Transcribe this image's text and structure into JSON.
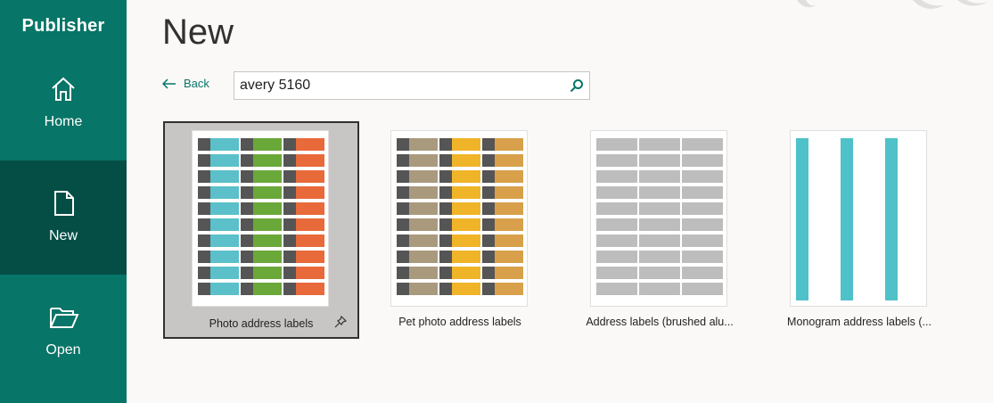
{
  "sidebar": {
    "app_title": "Publisher",
    "items": [
      {
        "label": "Home",
        "icon": "home-icon"
      },
      {
        "label": "New",
        "icon": "new-document-icon"
      },
      {
        "label": "Open",
        "icon": "folder-open-icon"
      }
    ],
    "active": "New"
  },
  "main": {
    "title": "New",
    "back_label": "Back",
    "search": {
      "value": "avery 5160",
      "icon": "search-icon"
    },
    "templates": [
      {
        "label": "Photo address labels",
        "selected": true,
        "pin_icon": "pin-icon",
        "colors": [
          "#5bc0c9",
          "#6aa83a",
          "#e86a3a"
        ]
      },
      {
        "label": "Pet photo address labels",
        "selected": false,
        "colors": [
          "#a99a7e",
          "#f0b429",
          "#d8a04a"
        ]
      },
      {
        "label": "Address labels (brushed alu...",
        "selected": false,
        "colors": [
          "#bdbdbd",
          "#bdbdbd",
          "#bdbdbd"
        ]
      },
      {
        "label": "Monogram address labels (...",
        "selected": false,
        "colors": [
          "#4fc1c8",
          "#4fc1c8",
          "#4fc1c8"
        ]
      }
    ]
  },
  "colors": {
    "sidebar_bg": "#077568",
    "sidebar_active": "#044e46",
    "accent": "#077568"
  }
}
